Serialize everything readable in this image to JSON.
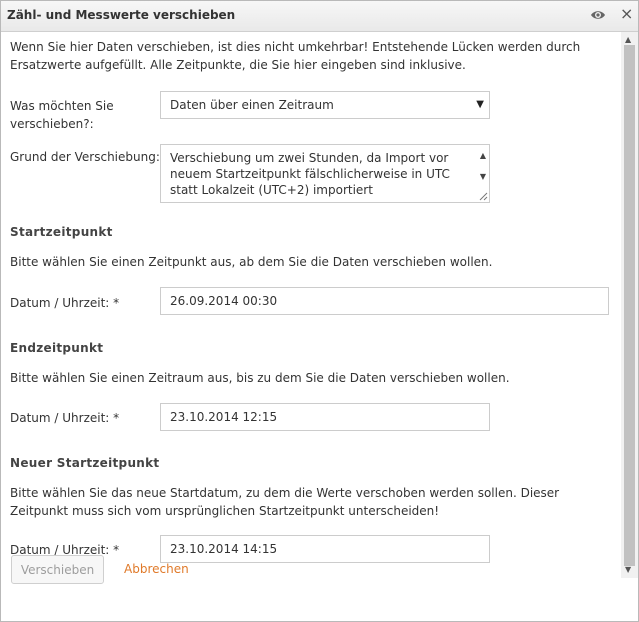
{
  "dialog": {
    "title": "Zähl- und Messwerte verschieben"
  },
  "intro": "Wenn Sie hier Daten verschieben, ist dies nicht umkehrbar! Entstehende Lücken werden durch Ersatzwerte aufgefüllt. Alle Zeitpunkte, die Sie hier eingeben sind inklusive.",
  "what": {
    "label": "Was möchten Sie verschieben?:",
    "value": "Daten über einen Zeitraum"
  },
  "reason": {
    "label": "Grund der Verschiebung: *",
    "value": "Verschiebung um zwei Stunden, da Import vor neuem Startzeitpunkt fälschlicherweise in UTC statt Lokalzeit (UTC+2) importiert"
  },
  "start": {
    "heading": "Startzeitpunkt",
    "description": "Bitte wählen Sie einen Zeitpunkt aus, ab dem Sie die Daten verschieben wollen.",
    "label": "Datum / Uhrzeit: *",
    "value": "26.09.2014 00:30"
  },
  "end": {
    "heading": "Endzeitpunkt",
    "description": "Bitte wählen Sie einen Zeitraum aus, bis zu dem Sie die Daten verschieben wollen.",
    "label": "Datum / Uhrzeit: *",
    "value": "23.10.2014 12:15"
  },
  "new_start": {
    "heading": "Neuer Startzeitpunkt",
    "description": "Bitte wählen Sie das neue Startdatum, zu dem die Werte verschoben werden sollen. Dieser Zeitpunkt muss sich vom ursprünglichen Startzeitpunkt unterscheiden!",
    "label": "Datum / Uhrzeit: *",
    "value": "23.10.2014 14:15"
  },
  "buttons": {
    "submit": "Verschieben",
    "cancel": "Abbrechen"
  },
  "icons": {
    "visibility": "eye-icon",
    "close": "close-icon",
    "dropdown": "caret-down-icon"
  },
  "colors": {
    "link": "#e07a2a",
    "disabled_button_text": "#9d9d9d"
  }
}
